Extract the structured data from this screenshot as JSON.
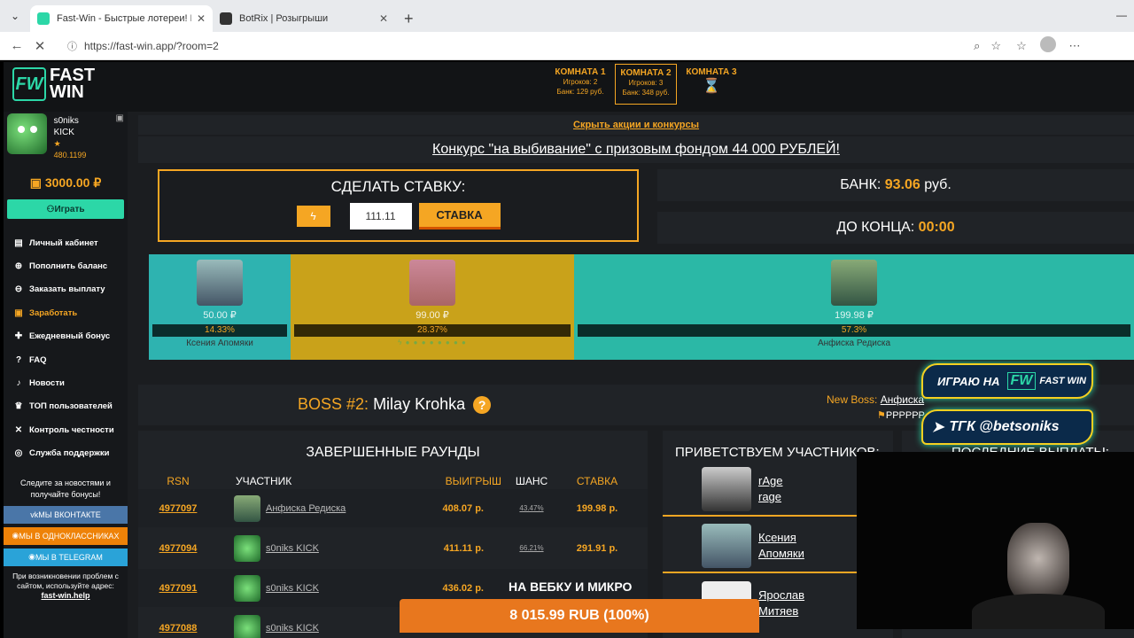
{
  "browser": {
    "tabs": [
      {
        "title": "Fast-Win - Быстрые лотереи! Ком"
      },
      {
        "title": "BotRix | Розыгрыши"
      }
    ],
    "url": "https://fast-win.app/?room=2"
  },
  "logo": {
    "fw": "FW",
    "word1": "FAST",
    "word2": "WIN"
  },
  "rooms": [
    {
      "name": "КОМНАТА 1",
      "players": "Игроков: 2",
      "bank": "Банк: 129 руб."
    },
    {
      "name": "КОМНАТА 2",
      "players": "Игроков: 3",
      "bank": "Банк: 348 руб."
    },
    {
      "name": "КОМНАТА 3"
    }
  ],
  "user": {
    "name": "s0niks",
    "sub": "KICK",
    "points": "★ 480.1199",
    "balance": "3000.00 ₽"
  },
  "sidebar": {
    "play": "Играть",
    "items": [
      {
        "label": "Личный кабинет"
      },
      {
        "label": "Пополнить баланс"
      },
      {
        "label": "Заказать выплату"
      },
      {
        "label": "Заработать"
      },
      {
        "label": "Ежедневный бонус"
      },
      {
        "label": "FAQ"
      },
      {
        "label": "Новости"
      },
      {
        "label": "ТОП пользователей"
      },
      {
        "label": "Контроль честности"
      },
      {
        "label": "Служба поддержки"
      }
    ],
    "news": "Следите за новостями и получайте бонусы!",
    "vk": "МЫ ВКОНТАКТЕ",
    "ok": "МЫ В ОДНОКЛАССНИКАХ",
    "tg": "МЫ В TELEGRAM",
    "help_text": "При возникновении проблем с сайтом, используйте адрес:",
    "help_link": "fast-win.help"
  },
  "main": {
    "hide_promo": "Скрыть акции и конкурсы",
    "contest": "Конкурс \"на выбивание\" с призовым фондом 44 000 РУБЛЕЙ!",
    "bet_title": "СДЕЛАТЬ СТАВКУ:",
    "bet_value": "111.11",
    "bet_button": "СТАВКА",
    "bank_label": "БАНК:",
    "bank_value": "93.06",
    "bank_unit": "руб.",
    "time_label": "ДО КОНЦА:",
    "time_value": "00:00"
  },
  "players": [
    {
      "amount": "50.00 ₽",
      "percent": "14.33%",
      "name": "Ксения Апомяки",
      "color": "#2eb3b0"
    },
    {
      "amount": "99.00 ₽",
      "percent": "28.37%",
      "name": "",
      "color": "#c9a21a"
    },
    {
      "amount": "199.98 ₽",
      "percent": "57.3%",
      "name": "Анфиска Редиска",
      "color": "#2bb8a6"
    }
  ],
  "boss": {
    "label": "BOSS #2:",
    "name": "Milay Krohka",
    "q": "?",
    "new_label": "New Boss:",
    "new_name": "Анфиска",
    "flag": "PPPPPP"
  },
  "rounds": {
    "title": "ЗАВЕРШЕННЫЕ РАУНДЫ",
    "headers": [
      "RSN",
      "УЧАСТНИК",
      "ВЫИГРЫШ",
      "ШАНС",
      "СТАВКА"
    ],
    "rows": [
      {
        "rsn": "4977097",
        "name": "Анфиска Редиска",
        "win": "408.07 р.",
        "chance": "43.47%",
        "stake": "199.98 р."
      },
      {
        "rsn": "4977094",
        "name": "s0niks KICK",
        "win": "411.11 р.",
        "chance": "66.21%",
        "stake": "291.91 р."
      },
      {
        "rsn": "4977091",
        "name": "s0niks KICK",
        "win": "436.02 р.",
        "chance": "",
        "stake": ""
      },
      {
        "rsn": "4977088",
        "name": "s0niks KICK",
        "win": "",
        "chance": "",
        "stake": ""
      }
    ]
  },
  "welcome": {
    "title": "ПРИВЕТСТВУЕМ УЧАСТНИКОВ:",
    "users": [
      {
        "l1": "rAge",
        "l2": "rage"
      },
      {
        "l1": "Ксения",
        "l2": "Апомяки"
      },
      {
        "l1": "Ярослав",
        "l2": "Митяев"
      }
    ]
  },
  "payouts": {
    "title": "ПОСЛЕДНИЕ ВЫПЛАТЫ:"
  },
  "overlay": {
    "promo1_text": "ИГРАЮ НА",
    "promo1_fw": "FW",
    "promo1_word": "FAST WIN",
    "promo2_text": "ТГК @betsoniks",
    "webcam_text": "НА ВЕБКУ И МИКРО",
    "goal": "8 015.99 RUB (100%)"
  }
}
